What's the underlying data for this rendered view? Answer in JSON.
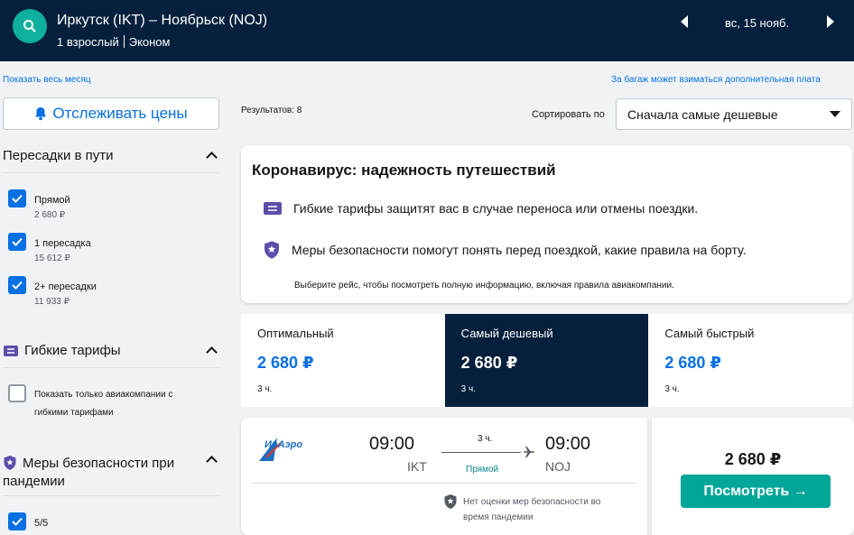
{
  "header": {
    "route": "Иркутск (IKT) – Ноябрьск (NOJ)",
    "passengers": "1 взрослый",
    "cabin": "Эконом",
    "date": "вс, 15 нояб."
  },
  "links": {
    "show_month": "Показать весь месяц",
    "baggage_note": "За багаж может взиматься дополнительная плата"
  },
  "track_button": "Отслеживать цены",
  "results": "Результатов: 8",
  "sort": {
    "label": "Сортировать по",
    "value": "Сначала самые дешевые"
  },
  "filters": {
    "stops": {
      "title": "Пересадки в пути",
      "options": [
        {
          "label": "Прямой",
          "price": "2 680 ₽",
          "checked": true
        },
        {
          "label": "1 пересадка",
          "price": "15 612 ₽",
          "checked": true
        },
        {
          "label": "2+ пересадки",
          "price": "11 933 ₽",
          "checked": true
        }
      ]
    },
    "flexible": {
      "title": "Гибкие тарифы",
      "option_line1": "Показать только авиакомпании с",
      "option_line2": "гибкими тарифами"
    },
    "safety": {
      "title_line1": "Меры безопасности при",
      "title_line2": "пандемии",
      "option": "5/5"
    }
  },
  "covid": {
    "title": "Коронавирус: надежность путешествий",
    "line1": "Гибкие тарифы защитят вас в случае переноса или отмены поездки.",
    "line2": "Меры безопасности помогут понять перед поездкой, какие правила на борту.",
    "note": "Выберите рейс, чтобы посмотреть полную информацию, включая правила авиакомпании."
  },
  "tabs": [
    {
      "label": "Оптимальный",
      "price": "2 680 ₽",
      "duration": "3 ч."
    },
    {
      "label": "Самый дешевый",
      "price": "2 680 ₽",
      "duration": "3 ч."
    },
    {
      "label": "Самый быстрый",
      "price": "2 680 ₽",
      "duration": "3 ч."
    }
  ],
  "flight": {
    "airline_logo_text": "ИрАэро",
    "dep_time": "09:00",
    "dep_code": "IKT",
    "arr_time": "09:00",
    "arr_code": "NOJ",
    "duration": "3 ч.",
    "stops": "Прямой",
    "safety_line1": "Нет оценки мер безопасности во",
    "safety_line2": "время пандемии",
    "price": "2 680 ₽",
    "button": "Посмотреть →"
  },
  "colors": {
    "navy": "#05203c",
    "blue": "#0770e3",
    "teal": "#00a698",
    "green": "#0c838a"
  }
}
